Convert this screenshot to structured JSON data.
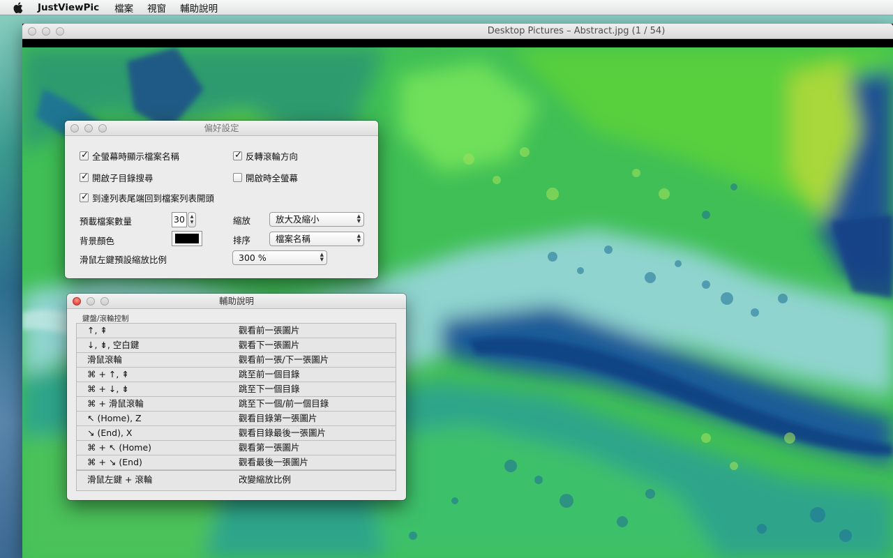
{
  "menubar": {
    "apple_icon": "apple-logo-icon",
    "app_name": "JustViewPic",
    "menus": [
      "檔案",
      "視窗",
      "輔助說明"
    ]
  },
  "viewer": {
    "title": "Desktop Pictures – Abstract.jpg (1 / 54)",
    "image_description_colors": [
      "#54d445",
      "#1e5a9a",
      "#8fd8d0",
      "#2aa07a"
    ]
  },
  "prefs": {
    "title": "偏好設定",
    "checkboxes": [
      {
        "label": "全螢幕時顯示檔案名稱",
        "checked": true
      },
      {
        "label": "反轉滾輪方向",
        "checked": true
      },
      {
        "label": "開啟子目錄搜尋",
        "checked": true
      },
      {
        "label": "開啟時全螢幕",
        "checked": false
      },
      {
        "label": "到達列表尾端回到檔案列表開頭",
        "checked": true
      }
    ],
    "preload_label": "預載檔案數量",
    "preload_value": "30",
    "zoom_label": "縮放",
    "zoom_value": "放大及縮小",
    "bg_label": "背景顏色",
    "bg_color": "#000000",
    "sort_label": "排序",
    "sort_value": "檔案名稱",
    "click_zoom_label": "滑鼠左鍵預設縮放比例",
    "click_zoom_value": "300 %"
  },
  "help": {
    "title": "輔助說明",
    "group_label": "鍵盤/滾輪控制",
    "rows": [
      {
        "key": "↑, ⇞",
        "desc": "觀看前一張圖片"
      },
      {
        "key": "↓, ⇟, 空白鍵",
        "desc": "觀看下一張圖片"
      },
      {
        "key": "滑鼠滾輪",
        "desc": "觀看前一張/下一張圖片"
      },
      {
        "key": "⌘ + ↑, ⇞",
        "desc": "跳至前一個目錄"
      },
      {
        "key": "⌘ + ↓, ⇟",
        "desc": "跳至下一個目錄"
      },
      {
        "key": "⌘ + 滑鼠滾輪",
        "desc": "跳至下一個/前一個目錄"
      },
      {
        "key": "↖ (Home), Z",
        "desc": "觀看目錄第一張圖片"
      },
      {
        "key": "↘ (End), X",
        "desc": "觀看目錄最後一張圖片"
      },
      {
        "key": "⌘ + ↖ (Home)",
        "desc": "觀看第一張圖片"
      },
      {
        "key": "⌘ + ↘ (End)",
        "desc": "觀看最後一張圖片"
      },
      {
        "key": "滑鼠左鍵 + 滾輪",
        "desc": "改變縮放比例"
      }
    ]
  }
}
